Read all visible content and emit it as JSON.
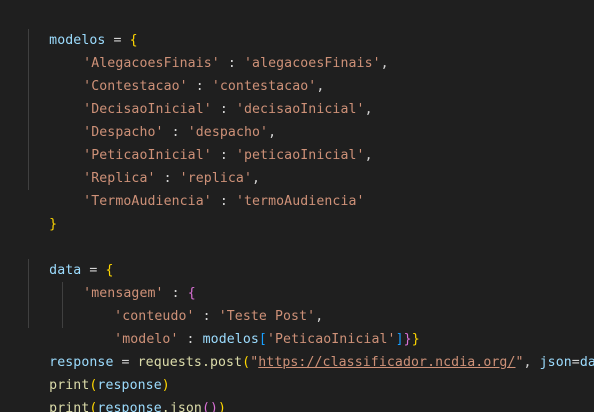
{
  "theme": {
    "background": "#1f1f1f",
    "variable": "#9cdcfe",
    "string": "#ce9178",
    "operator": "#d4d4d4",
    "function": "#dcdcaa",
    "bracket_level1": "#ffd700",
    "bracket_level2": "#da70d6",
    "bracket_level3": "#179fff"
  },
  "code": {
    "modelos_var": "modelos",
    "assign": " = ",
    "open_brace": "{",
    "close_brace": "}",
    "entries": [
      {
        "key": "'AlegacoesFinais'",
        "sep": " : ",
        "value": "'alegacoesFinais'",
        "comma": ","
      },
      {
        "key": "'Contestacao'",
        "sep": " : ",
        "value": "'contestacao'",
        "comma": ","
      },
      {
        "key": "'DecisaoInicial'",
        "sep": " : ",
        "value": "'decisaoInicial'",
        "comma": ","
      },
      {
        "key": "'Despacho'",
        "sep": " : ",
        "value": "'despacho'",
        "comma": ","
      },
      {
        "key": "'PeticaoInicial'",
        "sep": " : ",
        "value": "'peticaoInicial'",
        "comma": ","
      },
      {
        "key": "'Replica'",
        "sep": " : ",
        "value": "'replica'",
        "comma": ","
      },
      {
        "key": "'TermoAudiencia'",
        "sep": " : ",
        "value": "'termoAudiencia'",
        "comma": ""
      }
    ],
    "data_var": "data",
    "mensagem_key": "'mensagem'",
    "colon": " : ",
    "conteudo_key": "'conteudo'",
    "conteudo_value": "'Teste Post'",
    "comma": ",",
    "modelo_key": "'modelo'",
    "modelos_ref": "modelos",
    "open_bracket": "[",
    "peticao_key": "'PeticaoInicial'",
    "close_bracket": "]",
    "response_var": "response",
    "requests_post": "requests.post",
    "open_paren": "(",
    "quote": "\"",
    "url": "https://classificador.ncdia.org/",
    "json_kw": " json",
    "equals": "=",
    "data_ref": "data",
    "close_paren": ")",
    "print_fn": "print",
    "response_ref": "response",
    "dot_json": ".json",
    "empty_parens": "()"
  }
}
